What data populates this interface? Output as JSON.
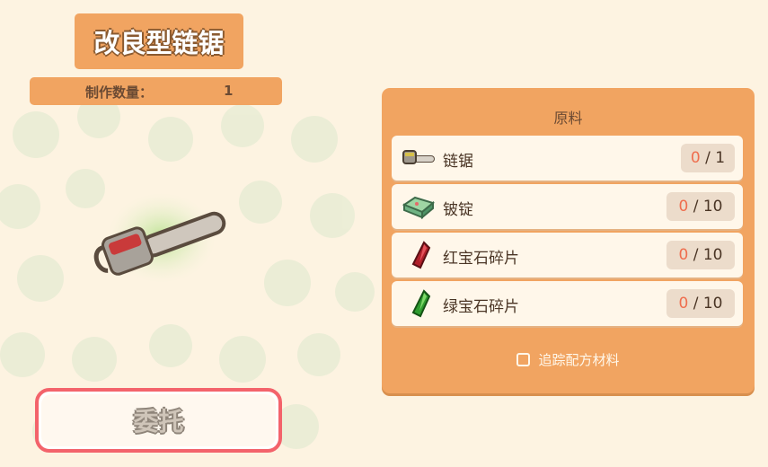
{
  "item": {
    "title": "改良型链锯",
    "qty_label": "制作数量：",
    "qty_value": "1",
    "icon": "chainsaw-icon"
  },
  "materials": {
    "title": "原料",
    "items": [
      {
        "label": "链锯",
        "have": "0",
        "need": "/ 1",
        "icon": "chainsaw-icon"
      },
      {
        "label": "铍锭",
        "have": "0",
        "need": "/ 10",
        "icon": "ingot-icon"
      },
      {
        "label": "红宝石碎片",
        "have": "0",
        "need": "/ 10",
        "icon": "ruby-shard-icon"
      },
      {
        "label": "绿宝石碎片",
        "have": "0",
        "need": "/ 10",
        "icon": "emerald-shard-icon"
      }
    ],
    "track_label": "追踪配方材料",
    "track_checked": false
  },
  "actions": {
    "commission_label": "委托"
  },
  "colors": {
    "accent": "#f1a461",
    "background": "#fdf3e1",
    "have_count": "#ef6e4e",
    "button_border": "#f3636b"
  }
}
